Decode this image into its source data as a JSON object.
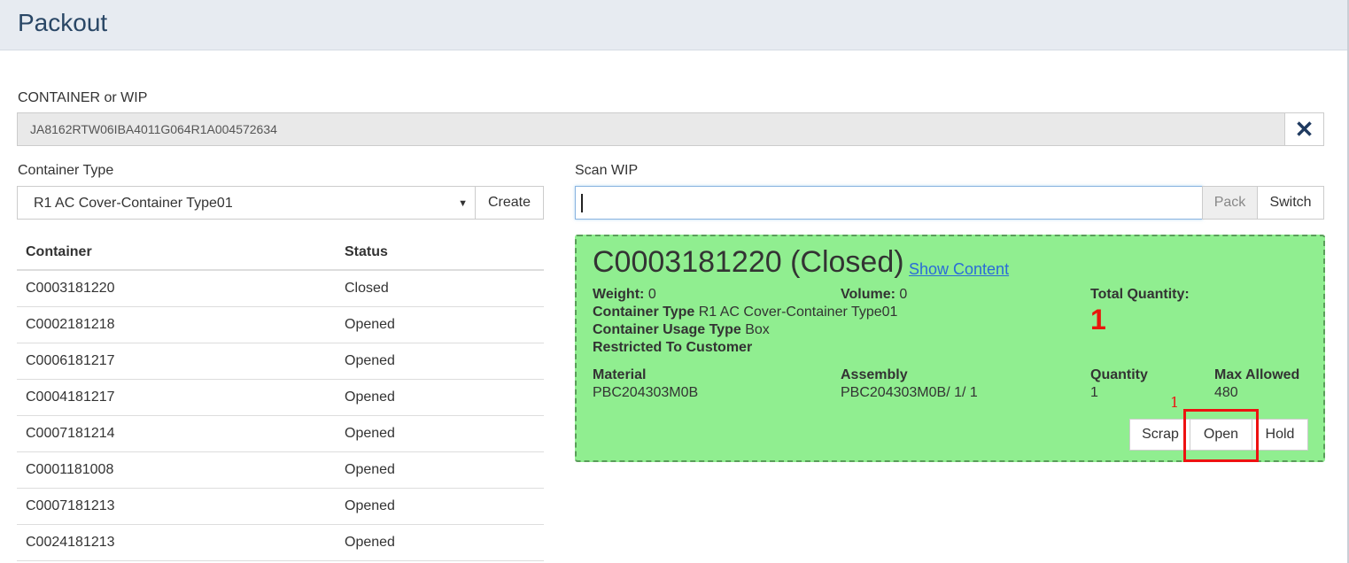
{
  "header": {
    "title": "Packout"
  },
  "container_or_wip": {
    "label": "CONTAINER or WIP",
    "value": "JA8162RTW06IBA4011G064R1A004572634",
    "clear_icon": "close-icon",
    "clear_glyph": "✕"
  },
  "container_type": {
    "label": "Container Type",
    "selected": "R1 AC Cover-Container Type01",
    "caret": "▼",
    "create_label": "Create"
  },
  "scan_wip": {
    "label": "Scan WIP",
    "value": "",
    "pack_label": "Pack",
    "switch_label": "Switch"
  },
  "table": {
    "headers": [
      "Container",
      "Status"
    ],
    "rows": [
      [
        "C0003181220",
        "Closed"
      ],
      [
        "C0002181218",
        "Opened"
      ],
      [
        "C0006181217",
        "Opened"
      ],
      [
        "C0004181217",
        "Opened"
      ],
      [
        "C0007181214",
        "Opened"
      ],
      [
        "C0001181008",
        "Opened"
      ],
      [
        "C0007181213",
        "Opened"
      ],
      [
        "C0024181213",
        "Opened"
      ]
    ]
  },
  "detail": {
    "title": "C0003181220 (Closed)",
    "show_content": "Show Content",
    "weight_label": "Weight:",
    "weight_value": "0",
    "volume_label": "Volume:",
    "volume_value": "0",
    "total_qty_label": "Total Quantity:",
    "total_qty_value": "1",
    "container_type_label": "Container Type",
    "container_type_value": "R1 AC Cover-Container Type01",
    "usage_type_label": "Container Usage Type",
    "usage_type_value": "Box",
    "restricted_label": "Restricted To Customer",
    "material_label": "Material",
    "material_value": "PBC204303M0B",
    "assembly_label": "Assembly",
    "assembly_value": "PBC204303M0B/ 1/ 1",
    "quantity_label": "Quantity",
    "quantity_value": "1",
    "max_allowed_label": "Max Allowed",
    "max_allowed_value": "480",
    "scrap_label": "Scrap",
    "open_label": "Open",
    "hold_label": "Hold"
  },
  "annotation": {
    "number": "1"
  },
  "colors": {
    "card_bg": "#90ee90",
    "total_qty": "#e8170c",
    "annotation": "#ee1111",
    "link": "#2a6bd8"
  }
}
